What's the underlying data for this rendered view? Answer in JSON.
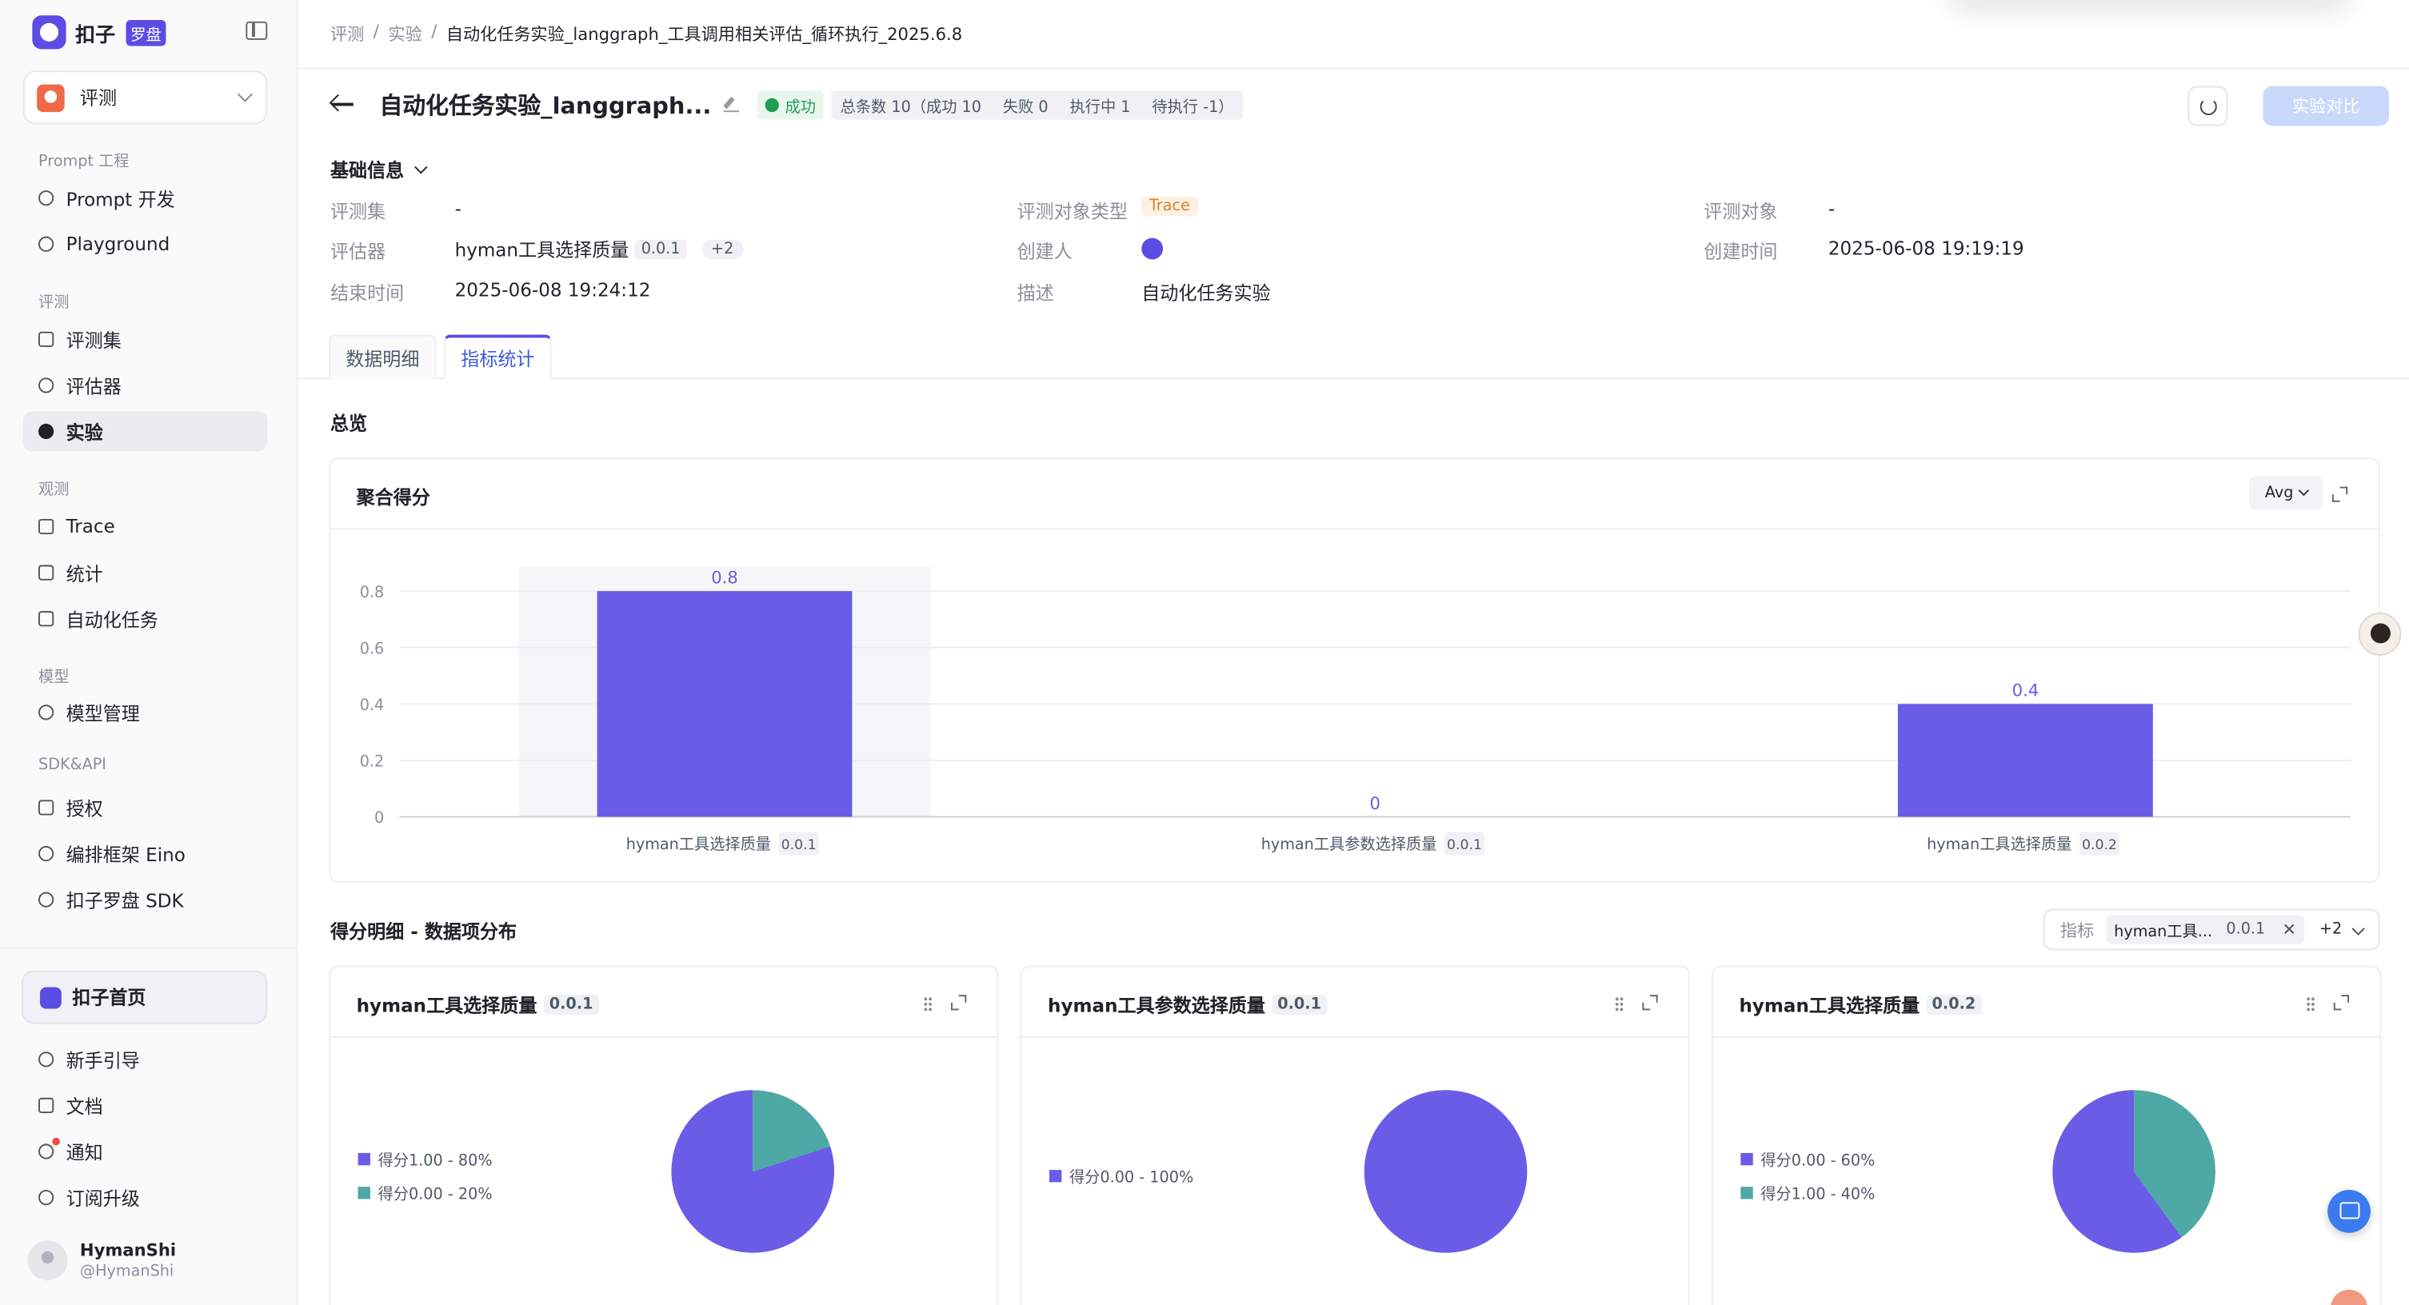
{
  "brand": {
    "name": "扣子",
    "badge": "罗盘"
  },
  "workspace": {
    "name": "评测"
  },
  "nav": {
    "groups": [
      {
        "label": "Prompt 工程",
        "items": [
          "Prompt 开发",
          "Playground"
        ]
      },
      {
        "label": "评测",
        "items": [
          "评测集",
          "评估器",
          "实验"
        ]
      },
      {
        "label": "观测",
        "items": [
          "Trace",
          "统计",
          "自动化任务"
        ]
      },
      {
        "label": "模型",
        "items": [
          "模型管理"
        ]
      },
      {
        "label": "SDK&API",
        "items": [
          "授权",
          "编排框架 Eino",
          "扣子罗盘 SDK"
        ]
      }
    ],
    "active": "实验",
    "home": "扣子首页",
    "bottom": [
      "新手引导",
      "文档",
      "通知",
      "订阅升级"
    ]
  },
  "user": {
    "name": "HymanShi",
    "handle": "@HymanShi"
  },
  "breadcrumb": [
    "评测",
    "实验",
    "自动化任务实验_langgraph_工具调用相关评估_循环执行_2025.6.8"
  ],
  "header": {
    "title": "自动化任务实验_langgraph...",
    "status": "成功",
    "stats": [
      "总条数 10（成功 10",
      "失败 0",
      "执行中 1",
      "待执行 -1）"
    ],
    "compare_button": "实验对比"
  },
  "basic_info": {
    "title": "基础信息",
    "fields": {
      "eval_set": {
        "label": "评测集",
        "value": "-"
      },
      "evaluator": {
        "label": "评估器",
        "value": "hyman工具选择质量",
        "version": "0.0.1",
        "more": "+2"
      },
      "end_time": {
        "label": "结束时间",
        "value": "2025-06-08 19:24:12"
      },
      "target_type": {
        "label": "评测对象类型",
        "value": "Trace"
      },
      "creator": {
        "label": "创建人"
      },
      "description": {
        "label": "描述",
        "value": "自动化任务实验"
      },
      "target": {
        "label": "评测对象",
        "value": "-"
      },
      "created_at": {
        "label": "创建时间",
        "value": "2025-06-08 19:19:19"
      }
    }
  },
  "tabs": [
    {
      "label": "数据明细",
      "active": false
    },
    {
      "label": "指标统计",
      "active": true
    }
  ],
  "overview_title": "总览",
  "aggregate": {
    "title": "聚合得分",
    "agg_select": "Avg",
    "colors": {
      "bar": "#6b5ce7",
      "highlight": "#f5f6f7",
      "value_label": "#6b5ce7"
    }
  },
  "detail_title": "得分明细 - 数据项分布",
  "metric_filter": {
    "label": "指标",
    "chip": "hyman工具...",
    "chip_version": "0.0.1",
    "more": "+2"
  },
  "chart_data": [
    {
      "type": "bar",
      "title": "聚合得分",
      "categories": [
        "hyman工具选择质量",
        "hyman工具参数选择质量",
        "hyman工具选择质量"
      ],
      "category_versions": [
        "0.0.1",
        "0.0.1",
        "0.0.2"
      ],
      "values": [
        0.8,
        0,
        0.4
      ],
      "yticks": [
        0,
        0.2,
        0.4,
        0.6,
        0.8
      ],
      "ylim": [
        0,
        0.8
      ],
      "grid": true
    },
    {
      "type": "pie",
      "title": "hyman工具选择质量",
      "version": "0.0.1",
      "slices": [
        {
          "label": "得分1.00 - 80%",
          "value": 80,
          "color": "#6b5ce7"
        },
        {
          "label": "得分0.00 - 20%",
          "value": 20,
          "color": "#4ea8a6"
        }
      ]
    },
    {
      "type": "pie",
      "title": "hyman工具参数选择质量",
      "version": "0.0.1",
      "slices": [
        {
          "label": "得分0.00 - 100%",
          "value": 100,
          "color": "#6b5ce7"
        }
      ]
    },
    {
      "type": "pie",
      "title": "hyman工具选择质量",
      "version": "0.0.2",
      "slices": [
        {
          "label": "得分0.00 - 60%",
          "value": 60,
          "color": "#6b5ce7"
        },
        {
          "label": "得分1.00 - 40%",
          "value": 40,
          "color": "#4ea8a6"
        }
      ]
    }
  ]
}
